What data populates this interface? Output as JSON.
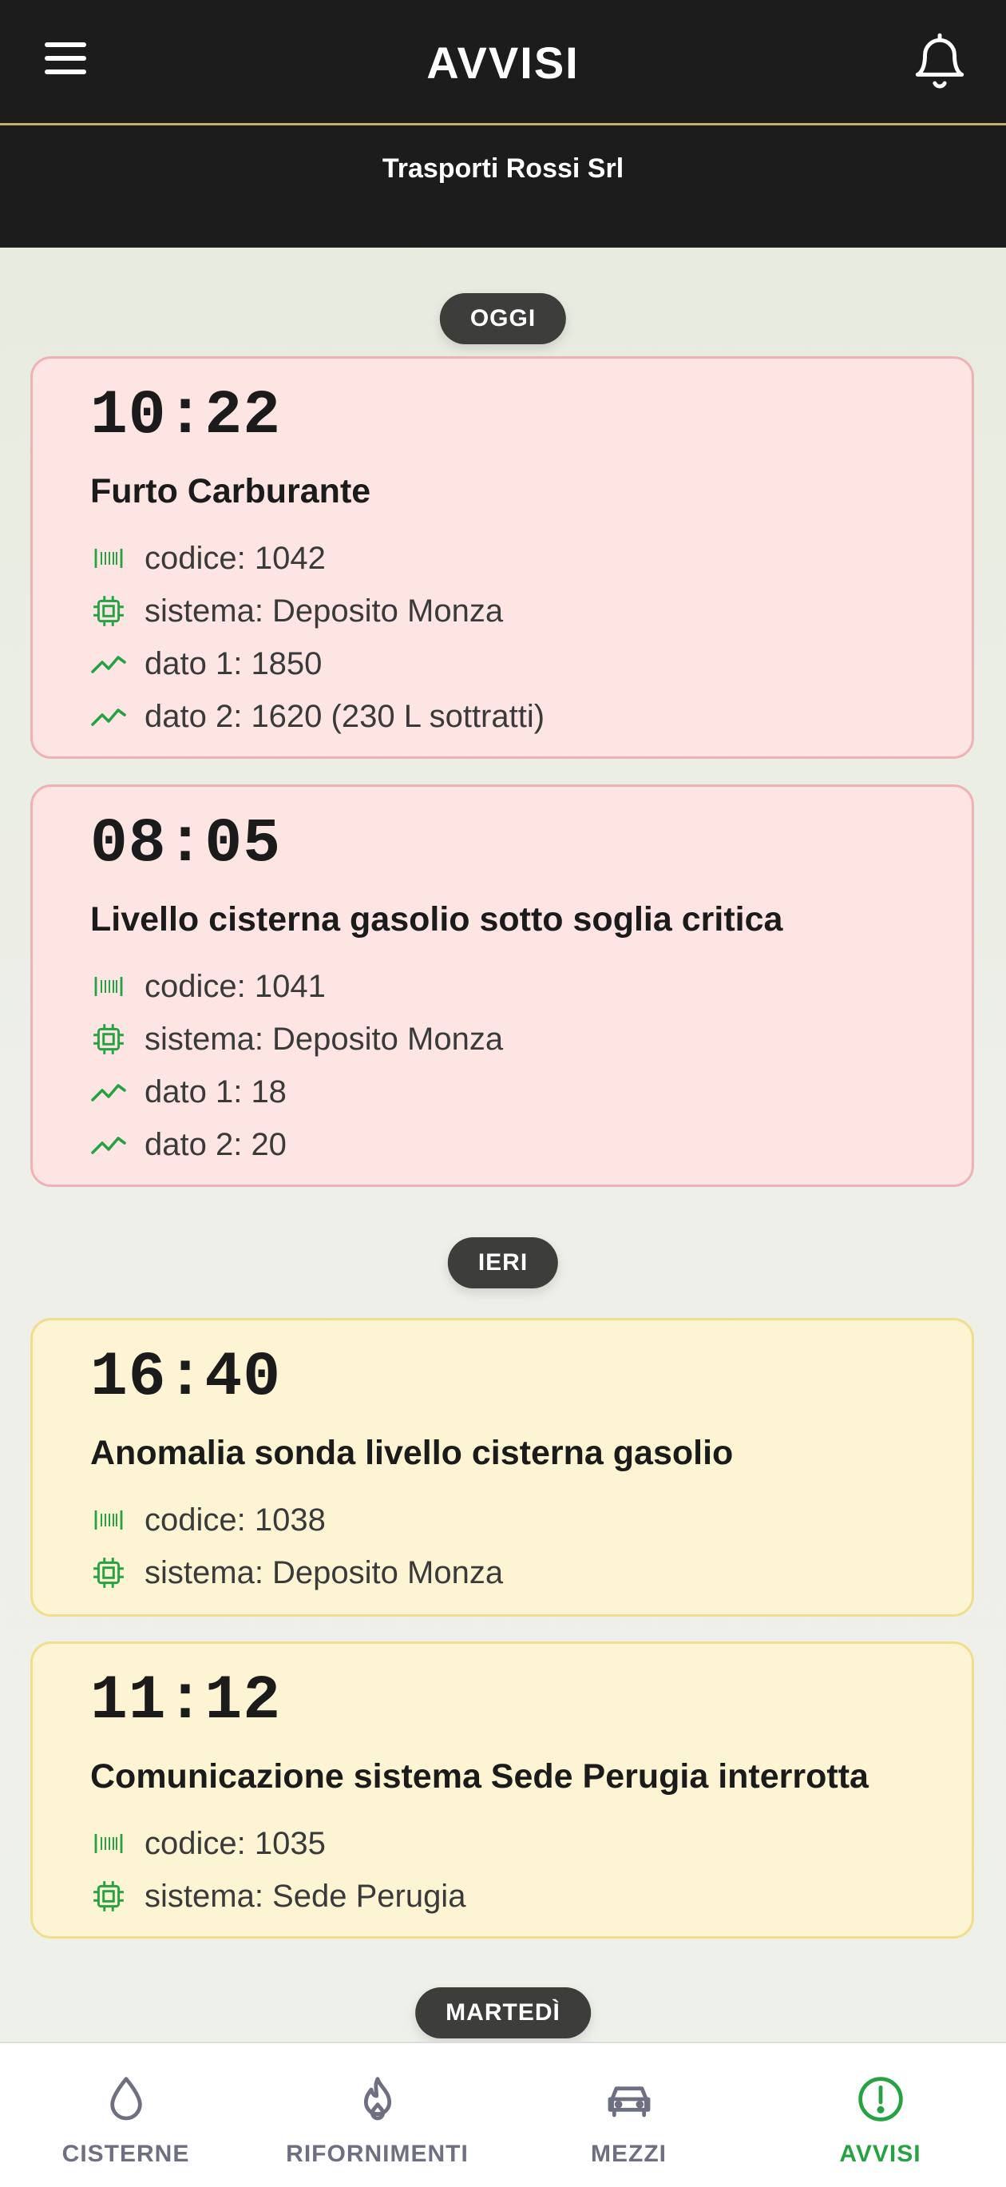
{
  "header": {
    "title": "AVVISI",
    "company": "Trasporti Rossi Srl"
  },
  "groups": {
    "today": "OGGI",
    "yesterday": "IERI",
    "tuesday": "MARTEDÌ"
  },
  "alerts": [
    {
      "time": "10:22",
      "title": "Furto Carburante",
      "severity": "critical",
      "rows": [
        {
          "icon": "barcode-icon",
          "text": "codice: 1042"
        },
        {
          "icon": "chip-icon",
          "text": "sistema: Deposito Monza"
        },
        {
          "icon": "trend-icon",
          "text": "dato 1: 1850"
        },
        {
          "icon": "trend-icon",
          "text": "dato 2: 1620 (230 L sottratti)"
        }
      ]
    },
    {
      "time": "08:05",
      "title": "Livello cisterna gasolio sotto soglia critica",
      "severity": "critical",
      "rows": [
        {
          "icon": "barcode-icon",
          "text": "codice: 1041"
        },
        {
          "icon": "chip-icon",
          "text": "sistema: Deposito Monza"
        },
        {
          "icon": "trend-icon",
          "text": "dato 1: 18"
        },
        {
          "icon": "trend-icon",
          "text": "dato 2: 20"
        }
      ]
    },
    {
      "time": "16:40",
      "title": "Anomalia sonda livello cisterna gasolio",
      "severity": "warning",
      "rows": [
        {
          "icon": "barcode-icon",
          "text": "codice: 1038"
        },
        {
          "icon": "chip-icon",
          "text": "sistema: Deposito Monza"
        }
      ]
    },
    {
      "time": "11:12",
      "title": "Comunicazione sistema Sede Perugia interrotta",
      "severity": "warning",
      "rows": [
        {
          "icon": "barcode-icon",
          "text": "codice: 1035"
        },
        {
          "icon": "chip-icon",
          "text": "sistema: Sede Perugia"
        }
      ]
    }
  ],
  "nav": [
    {
      "label": "CISTERNE",
      "icon": "droplet-icon"
    },
    {
      "label": "RIFORNIMENTI",
      "icon": "flame-icon"
    },
    {
      "label": "MEZZI",
      "icon": "car-icon"
    },
    {
      "label": "AVVISI",
      "icon": "alert-circle-icon",
      "active": true
    }
  ],
  "colors": {
    "header_bg": "#1c1c1c",
    "accent_line": "#c8b06a",
    "critical_bg": "#fde5e4",
    "warning_bg": "#fdf4d4",
    "icon_green": "#27a243",
    "nav_inactive": "#6e7081"
  }
}
